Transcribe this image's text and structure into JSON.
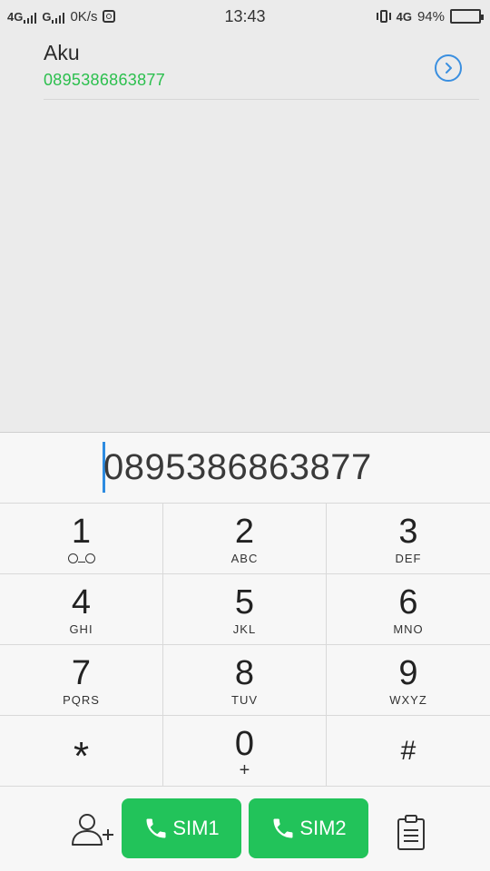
{
  "status_bar": {
    "net1": "4G",
    "net2": "G",
    "speed": "0K/s",
    "time": "13:43",
    "net3": "4G",
    "battery": "94%",
    "battery_level": 0.94
  },
  "suggestion": {
    "name": "Aku",
    "number": "0895386863877"
  },
  "dialer": {
    "entered_number": "0895386863877",
    "keys": [
      {
        "digit": "1",
        "letters": ""
      },
      {
        "digit": "2",
        "letters": "ABC"
      },
      {
        "digit": "3",
        "letters": "DEF"
      },
      {
        "digit": "4",
        "letters": "GHI"
      },
      {
        "digit": "5",
        "letters": "JKL"
      },
      {
        "digit": "6",
        "letters": "MNO"
      },
      {
        "digit": "7",
        "letters": "PQRS"
      },
      {
        "digit": "8",
        "letters": "TUV"
      },
      {
        "digit": "9",
        "letters": "WXYZ"
      },
      {
        "digit": "*",
        "letters": ""
      },
      {
        "digit": "0",
        "letters": "+"
      },
      {
        "digit": "#",
        "letters": ""
      }
    ]
  },
  "actions": {
    "sim1_label": "SIM1",
    "sim2_label": "SIM2"
  },
  "colors": {
    "accent_green": "#22c35a",
    "number_green": "#2bbf4d",
    "accent_blue": "#3a8fe0"
  },
  "icons": [
    "instagram-icon",
    "vibrate-icon",
    "battery-icon",
    "chevron-right-icon",
    "voicemail-icon",
    "add-contact-icon",
    "phone-icon",
    "clipboard-icon"
  ]
}
